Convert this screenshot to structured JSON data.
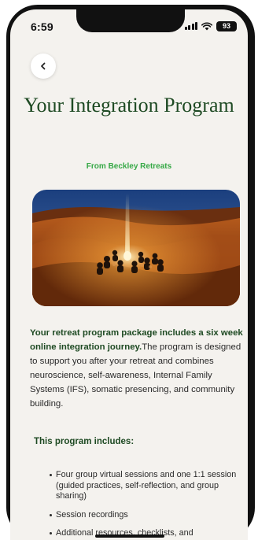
{
  "status_bar": {
    "time": "6:59",
    "battery": "93"
  },
  "nav": {
    "back_icon": "chevron-left-icon"
  },
  "header": {
    "title": "Your Integration Program",
    "subtitle": "From Beckley Retreats"
  },
  "hero_image": {
    "description_icon": "desert-campfire-photo"
  },
  "intro": {
    "lead": "Your retreat program package includes a six week online integration journey.",
    "body": "The program is designed to support you after your retreat and combines neuroscience, self-awareness, Internal Family Systems (IFS), somatic presencing, and community building."
  },
  "includes": {
    "heading": "This program includes:",
    "items": [
      "Four group virtual sessions and one 1:1 session (guided practices, self-reflection, and group sharing)",
      "Session recordings",
      "Additional resources, checklists, and"
    ]
  },
  "colors": {
    "background": "#f4f2ee",
    "title_green": "#1e4a23",
    "accent_green": "#35a845"
  }
}
